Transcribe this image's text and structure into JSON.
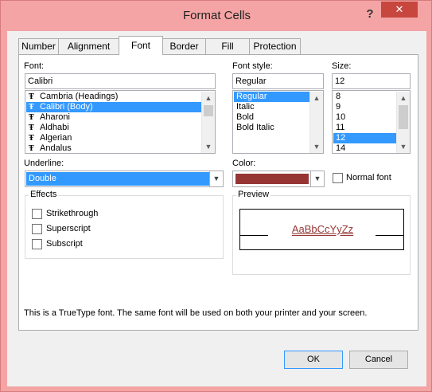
{
  "window": {
    "title": "Format Cells",
    "help_glyph": "?",
    "close_glyph": "✕"
  },
  "tabs": [
    {
      "label": "Number"
    },
    {
      "label": "Alignment"
    },
    {
      "label": "Font",
      "active": true
    },
    {
      "label": "Border"
    },
    {
      "label": "Fill"
    },
    {
      "label": "Protection"
    }
  ],
  "font": {
    "label": "Font:",
    "value": "Calibri",
    "items": [
      {
        "label": "Cambria (Headings)",
        "selected": false
      },
      {
        "label": "Calibri (Body)",
        "selected": true
      },
      {
        "label": "Aharoni",
        "selected": false
      },
      {
        "label": "Aldhabi",
        "selected": false
      },
      {
        "label": "Algerian",
        "selected": false
      },
      {
        "label": "Andalus",
        "selected": false
      }
    ],
    "tt_glyph": "Ŧ"
  },
  "font_style": {
    "label": "Font style:",
    "value": "Regular",
    "items": [
      {
        "label": "Regular",
        "selected": true
      },
      {
        "label": "Italic",
        "selected": false
      },
      {
        "label": "Bold",
        "selected": false
      },
      {
        "label": "Bold Italic",
        "selected": false
      }
    ]
  },
  "size": {
    "label": "Size:",
    "value": "12",
    "items": [
      {
        "label": "8",
        "selected": false
      },
      {
        "label": "9",
        "selected": false
      },
      {
        "label": "10",
        "selected": false
      },
      {
        "label": "11",
        "selected": false
      },
      {
        "label": "12",
        "selected": true
      },
      {
        "label": "14",
        "selected": false
      }
    ]
  },
  "underline": {
    "label": "Underline:",
    "value": "Double"
  },
  "color": {
    "label": "Color:",
    "swatch": "#963634",
    "normal_font_label": "Normal font"
  },
  "effects": {
    "title": "Effects",
    "strikethrough": "Strikethrough",
    "superscript": "Superscript",
    "subscript": "Subscript"
  },
  "preview": {
    "title": "Preview",
    "sample": "AaBbCcYyZz",
    "sample_color": "#963634"
  },
  "info_text": "This is a TrueType font.  The same font will be used on both your printer and your screen.",
  "buttons": {
    "ok": "OK",
    "cancel": "Cancel"
  },
  "colors": {
    "frame": "#f4a4a4",
    "selection": "#3399ff",
    "close": "#c7463e"
  }
}
